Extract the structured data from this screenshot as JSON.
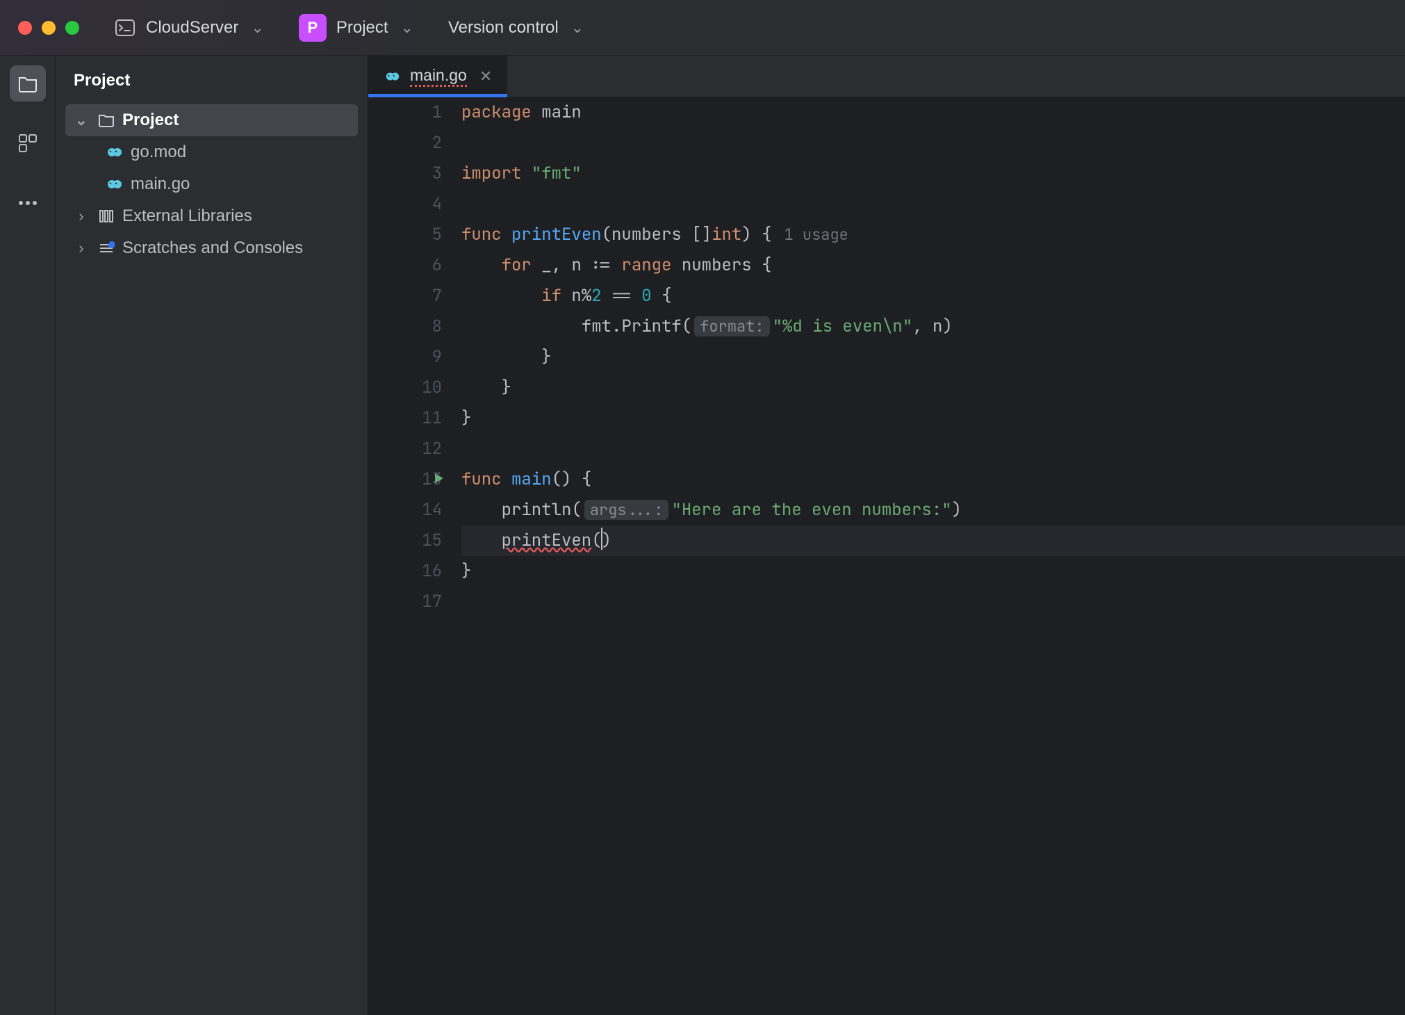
{
  "titlebar": {
    "server_label": "CloudServer",
    "project_badge": "P",
    "project_label": "Project",
    "vcs_label": "Version control"
  },
  "panel": {
    "title": "Project",
    "tree": {
      "root": "Project",
      "files": [
        "go.mod",
        "main.go"
      ],
      "ext_lib": "External Libraries",
      "scratches": "Scratches and Consoles"
    }
  },
  "tab": {
    "filename": "main.go"
  },
  "code": {
    "lines": {
      "1": {
        "n": "1"
      },
      "2": {
        "n": "2"
      },
      "3": {
        "n": "3"
      },
      "4": {
        "n": "4"
      },
      "5": {
        "n": "5"
      },
      "6": {
        "n": "6"
      },
      "7": {
        "n": "7"
      },
      "8": {
        "n": "8"
      },
      "9": {
        "n": "9"
      },
      "10": {
        "n": "10"
      },
      "11": {
        "n": "11"
      },
      "12": {
        "n": "12"
      },
      "13": {
        "n": "13"
      },
      "14": {
        "n": "14"
      },
      "15": {
        "n": "15"
      },
      "16": {
        "n": "16"
      },
      "17": {
        "n": "17"
      }
    },
    "tokens": {
      "package": "package",
      "main": "main",
      "import": "import",
      "fmt_str": "\"fmt\"",
      "func": "func",
      "printEven": "printEven",
      "lp": "(",
      "rp": ")",
      "numbers_param": "numbers",
      "slice": "[]",
      "int": "int",
      "lb": "{",
      "rb": "}",
      "usage": "1 usage",
      "for": "for",
      "underscore": "_",
      "comma": ",",
      "n": "n",
      "walrus": ":=",
      "range": "range",
      "numbers": "numbers",
      "if": "if",
      "mod": "n%",
      "two": "2",
      "eqeq": " == ",
      "zero": "0",
      "fmtPrintf": "fmt.Printf",
      "hint_format": "format:",
      "fmtstr": "\"%d is even\\n\"",
      "comma2": ", ",
      "n2": "n",
      "main_fn": "main",
      "unit": "()",
      "println": "println",
      "hint_args": "args...:",
      "herestr": "\"Here are the even numbers:\"",
      "printEven_call": "printEven"
    }
  }
}
